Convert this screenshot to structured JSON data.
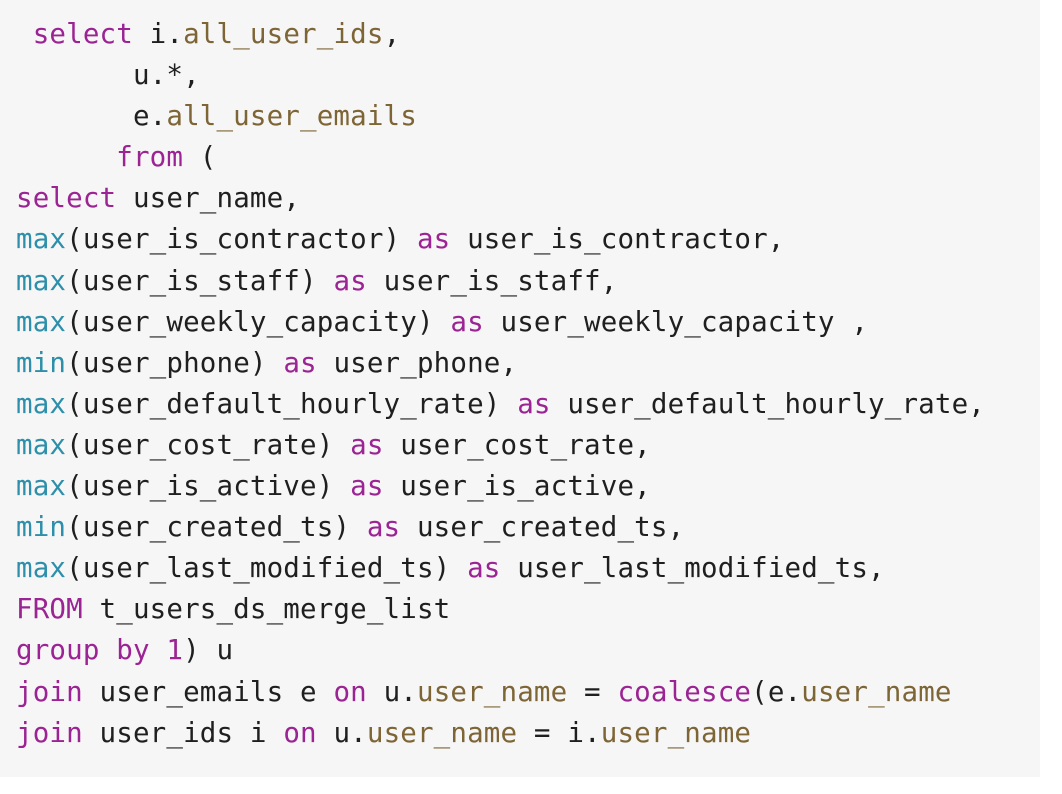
{
  "colors": {
    "background": "#f6f6f6",
    "keyword": "#9b2393",
    "function": "#2d8faa",
    "column": "#7d6536",
    "plain": "#1f1f1f"
  },
  "code": {
    "lines": [
      [
        {
          "t": " ",
          "c": "plain"
        },
        {
          "t": "select",
          "c": "kw"
        },
        {
          "t": " i.",
          "c": "plain"
        },
        {
          "t": "all_user_ids",
          "c": "col"
        },
        {
          "t": ",",
          "c": "plain"
        }
      ],
      [
        {
          "t": "       u.*,",
          "c": "plain"
        }
      ],
      [
        {
          "t": "       e.",
          "c": "plain"
        },
        {
          "t": "all_user_emails",
          "c": "col"
        }
      ],
      [
        {
          "t": "      ",
          "c": "plain"
        },
        {
          "t": "from",
          "c": "kw"
        },
        {
          "t": " (",
          "c": "plain"
        }
      ],
      [
        {
          "t": "select",
          "c": "kw"
        },
        {
          "t": " user_name,",
          "c": "plain"
        }
      ],
      [
        {
          "t": "max",
          "c": "fn"
        },
        {
          "t": "(user_is_contractor) ",
          "c": "plain"
        },
        {
          "t": "as",
          "c": "kw"
        },
        {
          "t": " user_is_contractor,",
          "c": "plain"
        }
      ],
      [
        {
          "t": "max",
          "c": "fn"
        },
        {
          "t": "(user_is_staff) ",
          "c": "plain"
        },
        {
          "t": "as",
          "c": "kw"
        },
        {
          "t": " user_is_staff,",
          "c": "plain"
        }
      ],
      [
        {
          "t": "max",
          "c": "fn"
        },
        {
          "t": "(user_weekly_capacity) ",
          "c": "plain"
        },
        {
          "t": "as",
          "c": "kw"
        },
        {
          "t": " user_weekly_capacity ,",
          "c": "plain"
        }
      ],
      [
        {
          "t": "min",
          "c": "fn"
        },
        {
          "t": "(user_phone) ",
          "c": "plain"
        },
        {
          "t": "as",
          "c": "kw"
        },
        {
          "t": " user_phone,",
          "c": "plain"
        }
      ],
      [
        {
          "t": "max",
          "c": "fn"
        },
        {
          "t": "(user_default_hourly_rate) ",
          "c": "plain"
        },
        {
          "t": "as",
          "c": "kw"
        },
        {
          "t": " user_default_hourly_rate,",
          "c": "plain"
        }
      ],
      [
        {
          "t": "max",
          "c": "fn"
        },
        {
          "t": "(user_cost_rate) ",
          "c": "plain"
        },
        {
          "t": "as",
          "c": "kw"
        },
        {
          "t": " user_cost_rate,",
          "c": "plain"
        }
      ],
      [
        {
          "t": "max",
          "c": "fn"
        },
        {
          "t": "(user_is_active) ",
          "c": "plain"
        },
        {
          "t": "as",
          "c": "kw"
        },
        {
          "t": " user_is_active,",
          "c": "plain"
        }
      ],
      [
        {
          "t": "min",
          "c": "fn"
        },
        {
          "t": "(user_created_ts) ",
          "c": "plain"
        },
        {
          "t": "as",
          "c": "kw"
        },
        {
          "t": " user_created_ts,",
          "c": "plain"
        }
      ],
      [
        {
          "t": "max",
          "c": "fn"
        },
        {
          "t": "(user_last_modified_ts) ",
          "c": "plain"
        },
        {
          "t": "as",
          "c": "kw"
        },
        {
          "t": " user_last_modified_ts,",
          "c": "plain"
        }
      ],
      [
        {
          "t": "FROM",
          "c": "kw"
        },
        {
          "t": " t_users_ds_merge_list",
          "c": "plain"
        }
      ],
      [
        {
          "t": "group by",
          "c": "kw"
        },
        {
          "t": " ",
          "c": "plain"
        },
        {
          "t": "1",
          "c": "num"
        },
        {
          "t": ") u",
          "c": "plain"
        }
      ],
      [
        {
          "t": "join",
          "c": "kw"
        },
        {
          "t": " user_emails e ",
          "c": "plain"
        },
        {
          "t": "on",
          "c": "kw"
        },
        {
          "t": " u.",
          "c": "plain"
        },
        {
          "t": "user_name",
          "c": "col"
        },
        {
          "t": " = ",
          "c": "plain"
        },
        {
          "t": "coalesce",
          "c": "kw"
        },
        {
          "t": "(e.",
          "c": "plain"
        },
        {
          "t": "user_name",
          "c": "col"
        }
      ],
      [
        {
          "t": "join",
          "c": "kw"
        },
        {
          "t": " user_ids i ",
          "c": "plain"
        },
        {
          "t": "on",
          "c": "kw"
        },
        {
          "t": " u.",
          "c": "plain"
        },
        {
          "t": "user_name",
          "c": "col"
        },
        {
          "t": " = i.",
          "c": "plain"
        },
        {
          "t": "user_name",
          "c": "col"
        }
      ]
    ]
  }
}
